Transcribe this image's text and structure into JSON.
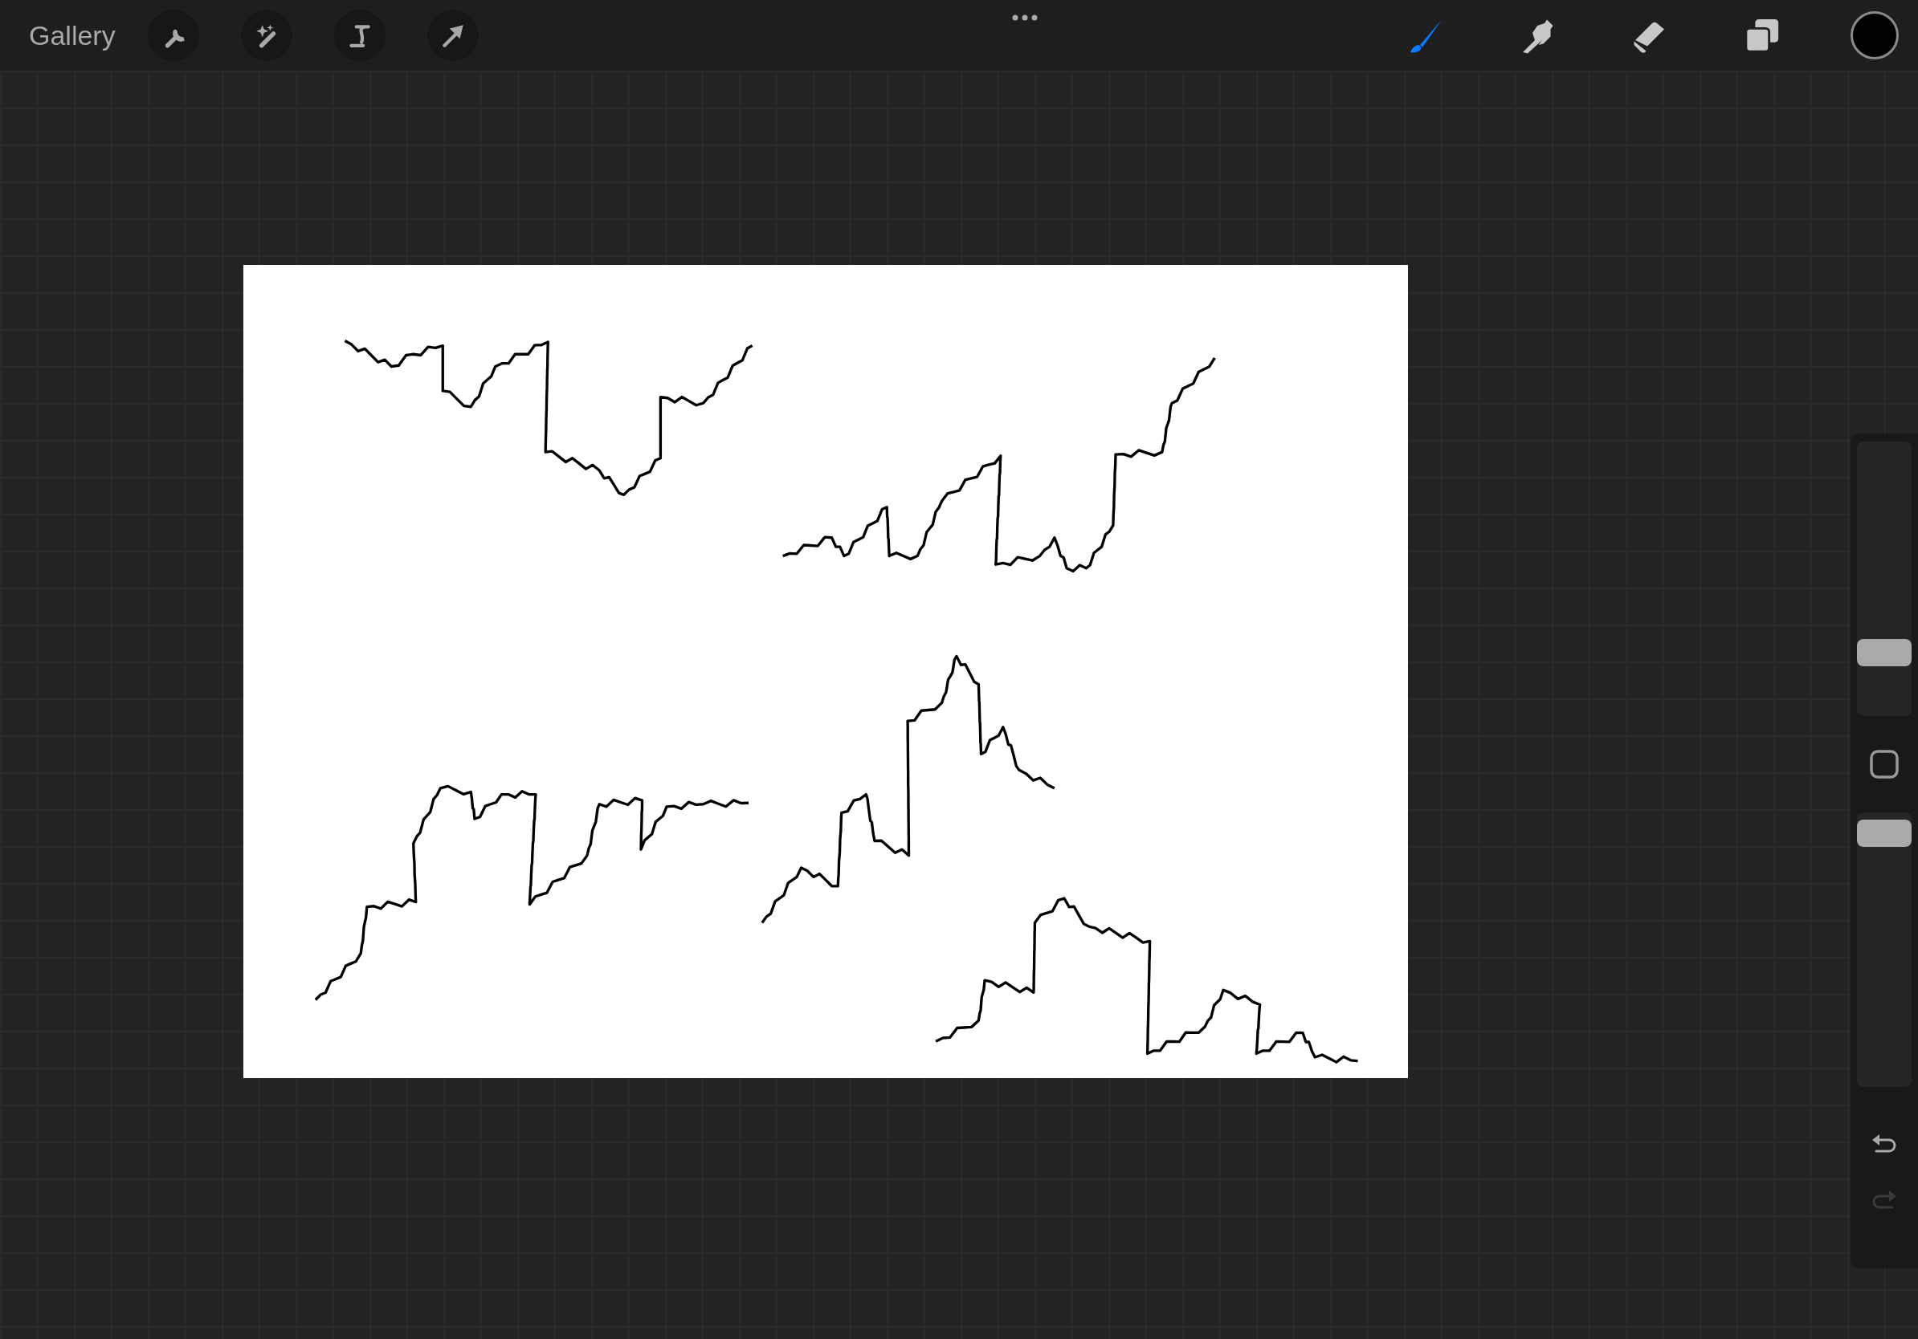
{
  "toolbar": {
    "gallery": "Gallery",
    "actions": [
      {
        "kind": "wrench"
      },
      {
        "kind": "wand"
      },
      {
        "kind": "selection"
      },
      {
        "kind": "transform"
      }
    ],
    "tools": [
      {
        "kind": "brush",
        "selected": true
      },
      {
        "kind": "smudge",
        "selected": false
      },
      {
        "kind": "eraser",
        "selected": false
      }
    ],
    "current_color": {
      "color": "#000000"
    }
  },
  "sidebar": {
    "size_slider": {
      "level": 0.2
    },
    "opacity_slider": {
      "level": 0.97
    },
    "undo": {
      "disabled": false
    },
    "redo": {
      "disabled": true
    }
  }
}
